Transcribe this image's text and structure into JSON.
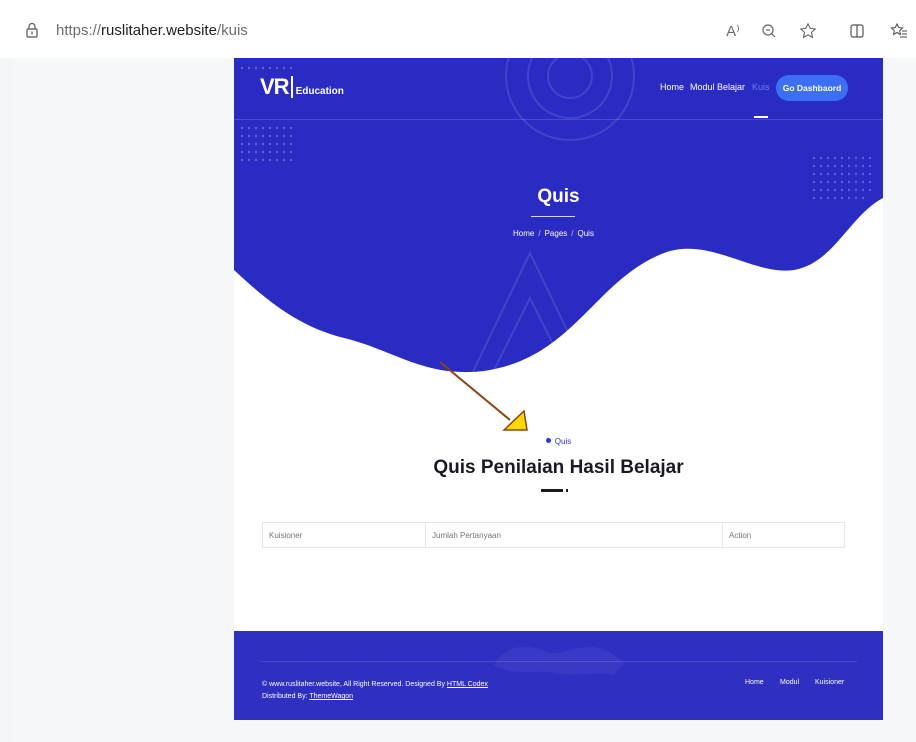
{
  "browser": {
    "url_scheme": "https://",
    "url_host": "ruslitaher.website",
    "url_path": "/kuis",
    "read_aloud_icon_text": "A⁾"
  },
  "header": {
    "logo_mark": "VR",
    "logo_text": "Education",
    "nav": [
      {
        "label": "Home"
      },
      {
        "label": "Modul Belajar"
      },
      {
        "label": "Kuis"
      }
    ],
    "cta": "Go Dashbaord"
  },
  "hero": {
    "title": "Quis",
    "breadcrumbs": [
      "Home",
      "Pages",
      "Quis"
    ],
    "separator": "/"
  },
  "main": {
    "tag": "Quis",
    "title": "Quis Penilaian Hasil Belajar",
    "table_headers": [
      "Kuisioner",
      "Jumlah Pertanyaan",
      "Action"
    ]
  },
  "footer": {
    "copyright": "© www.ruslitaher.website, All Right Reserved. Designed By",
    "designer": "HTML Codex",
    "distributed_label": "Distributed By:",
    "distributor": "ThemeWagon",
    "links": [
      "Home",
      "Modul",
      "Kuisioner"
    ]
  },
  "colors": {
    "hero_blue": "#2a2bc3",
    "button_blue": "#3d6ff5",
    "footer_blue": "#2f2fc2",
    "arrow_brown": "#8b4513",
    "arrow_yellow": "#ffd800"
  }
}
